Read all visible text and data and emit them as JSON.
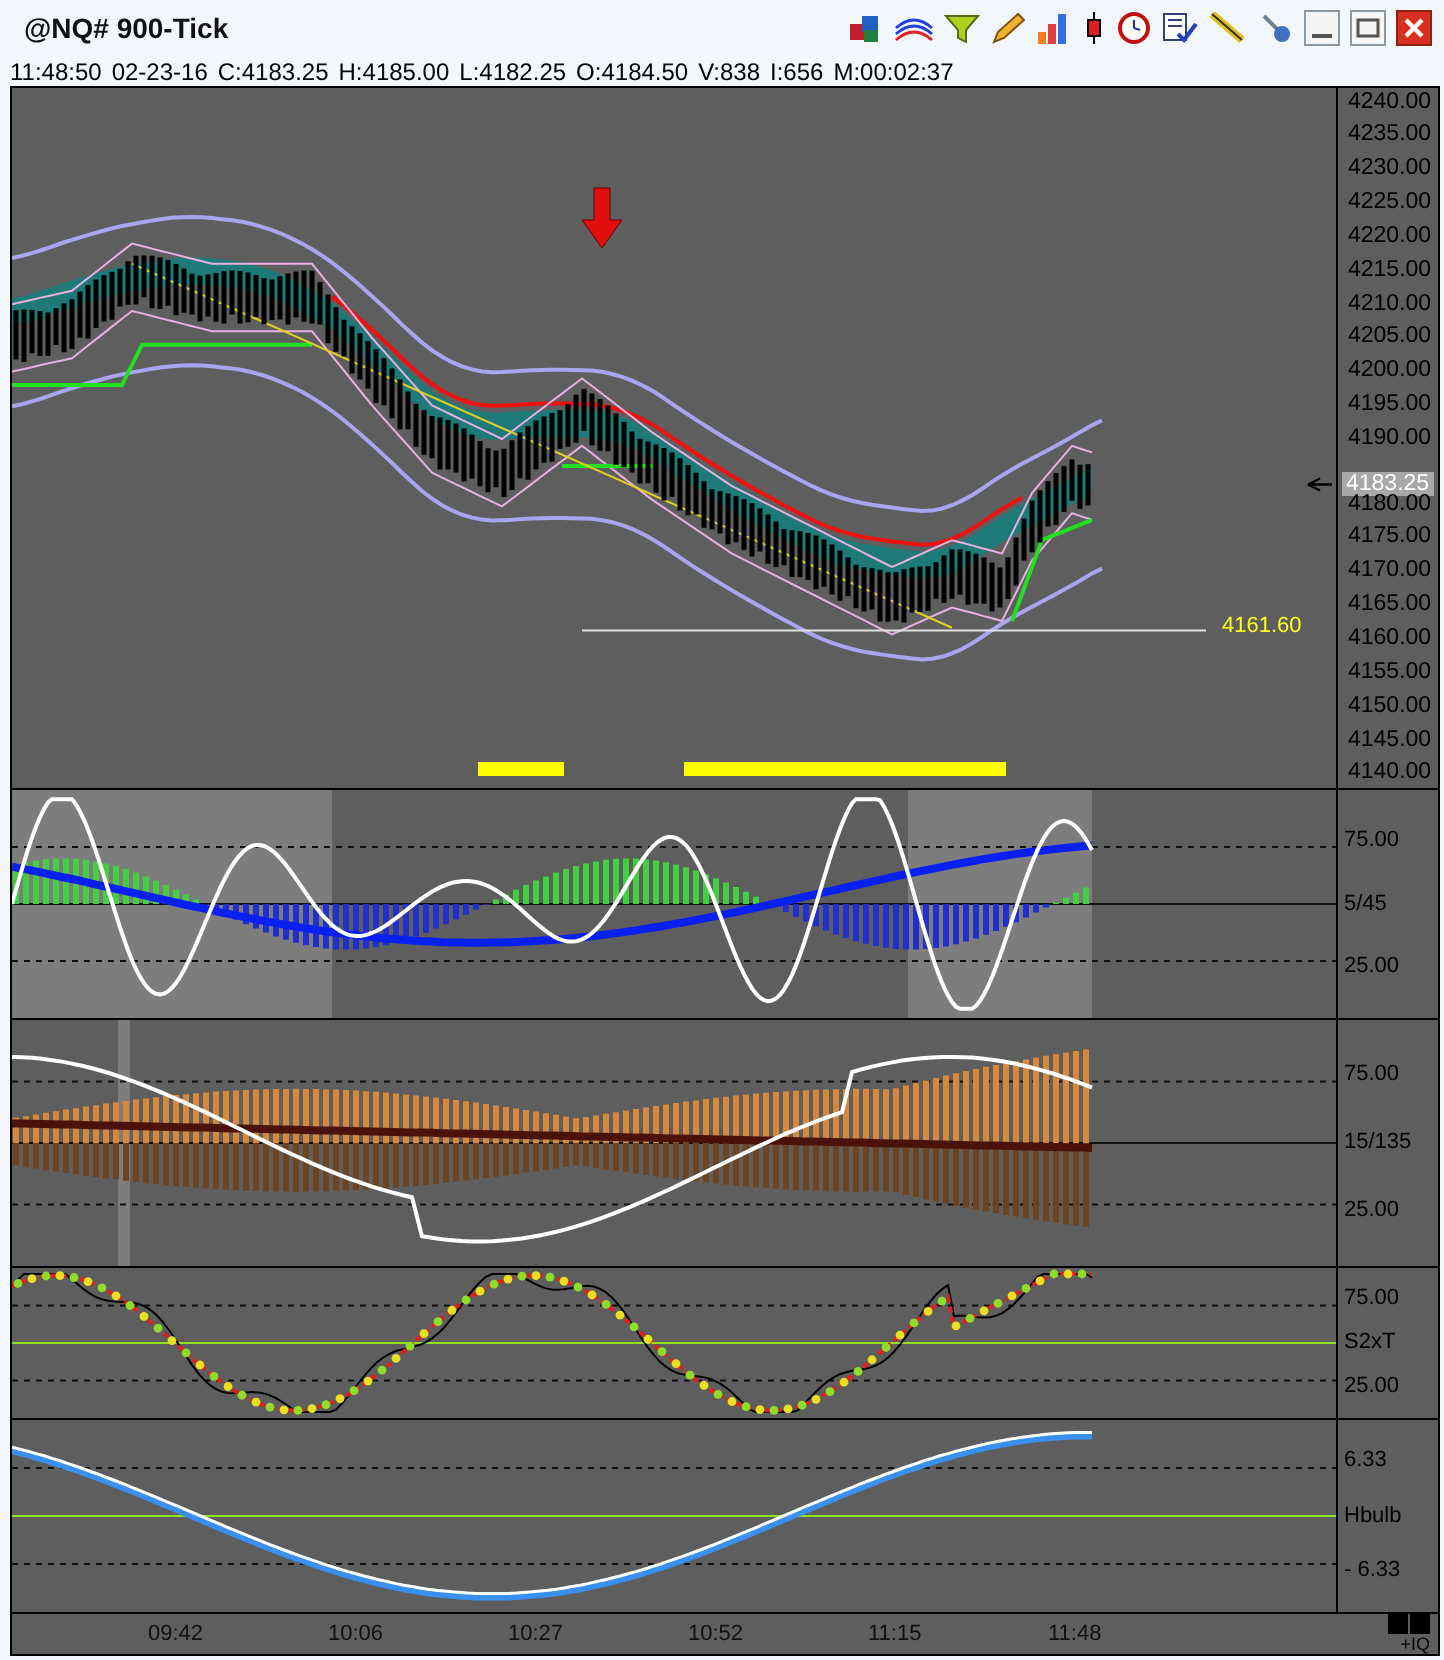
{
  "window": {
    "title": "@NQ# 900-Tick"
  },
  "quote_line": [
    "11:48:50",
    "02-23-16",
    "C:4183.25",
    "H:4185.00",
    "L:4182.25",
    "O:4184.50",
    "V:838",
    "I:656",
    "M:00:02:37"
  ],
  "price_pane": {
    "axis_labels_above": [
      "4240.00",
      "4235.00",
      "4230.00",
      "4225.00",
      "4220.00",
      "4215.00",
      "4210.00",
      "4205.00",
      "4200.00",
      "4195.00",
      "4190.00"
    ],
    "last_price": "4183.25",
    "axis_labels_below": [
      "4180.00",
      "4175.00",
      "4170.00",
      "4165.00",
      "4160.00",
      "4155.00",
      "4150.00",
      "4145.00",
      "4140.00"
    ],
    "level_line_label": "4161.60"
  },
  "indicator_panes": [
    {
      "kind": "histogram",
      "labels": [
        "75.00",
        "5/45",
        "25.00"
      ]
    },
    {
      "kind": "bands",
      "labels": [
        "75.00",
        "15/135",
        "25.00"
      ]
    },
    {
      "kind": "dots",
      "labels": [
        "75.00",
        "S2xT",
        "25.00"
      ]
    },
    {
      "kind": "wave",
      "labels": [
        "6.33",
        "Hbulb",
        "- 6.33"
      ]
    }
  ],
  "time_axis": [
    "09:42",
    "10:06",
    "10:27",
    "10:52",
    "11:15",
    "11:48"
  ],
  "corner_label": "+IQ"
}
